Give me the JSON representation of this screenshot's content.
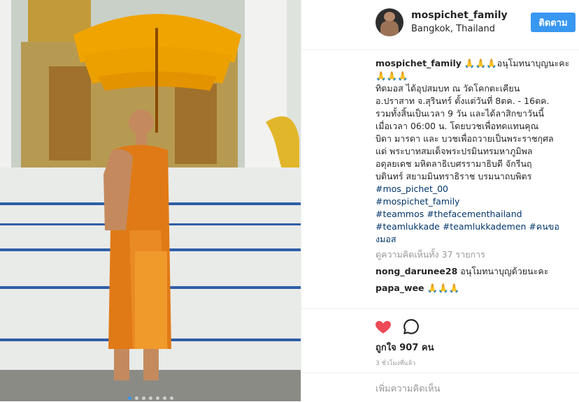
{
  "post": {
    "username": "mospichet_family",
    "location": "Bangkok, Thailand",
    "follow_label": "ติดตาม"
  },
  "caption": {
    "username": "mospichet_family",
    "lines": [
      "🙏🙏🙏อนุโมทนาบุญนะคะ",
      "🙏🙏🙏",
      "ทิดมอส ได้อุปสมบท ณ วัดโคกตะเคียน",
      "อ.ปราสาท จ.สุรินทร์ ตั้งแต่วันที่ 8ตค. - 16ตค.",
      "รวมทั้งสิ้นเป็นเวลา 9 วัน และได้ลาสิกขาวันนี้",
      "เมื่อเวลา 06:00 น. โดยบวชเพื่อทดแทนคุณ",
      "บิดา มารดา และ บวชเพื่อถวายเป็นพระราชกุศล",
      "แด่ พระบาทสมเด็จพระปรมินทรมหาภูมิพล",
      "อดุลยเดช มหิตลาธิเบศรรามาธิบดี จักรีนฤ",
      "บดินทร์ สยามมินทราธิราช บรมนาถบพิตร"
    ],
    "hashtags": [
      "#mos_pichet_00",
      "#mospichet_family",
      "#teammos #thefacementhailand",
      "#teamlukkade #teamlukkademen #คนขอ",
      "งมอส"
    ]
  },
  "view_all_comments": "ดูความคิดเห็นทั้ง 37 รายการ",
  "comments": [
    {
      "username": "nong_darunee28",
      "text": "อนุโมทนาบุญด้วยนะคะ"
    },
    {
      "username": "papa_wee",
      "text": "🙏🙏🙏"
    }
  ],
  "actions": {
    "like_icon": "heart-icon",
    "comment_icon": "comment-bubble-icon",
    "like_color": "#ed4956"
  },
  "likes_text": "ถูกใจ 907 คน",
  "time_ago": "3 ชั่วโมงที่แล้ว",
  "add_comment_placeholder": "เพิ่มความคิดเห็น",
  "carousel": {
    "count": 7,
    "active_index": 0
  }
}
